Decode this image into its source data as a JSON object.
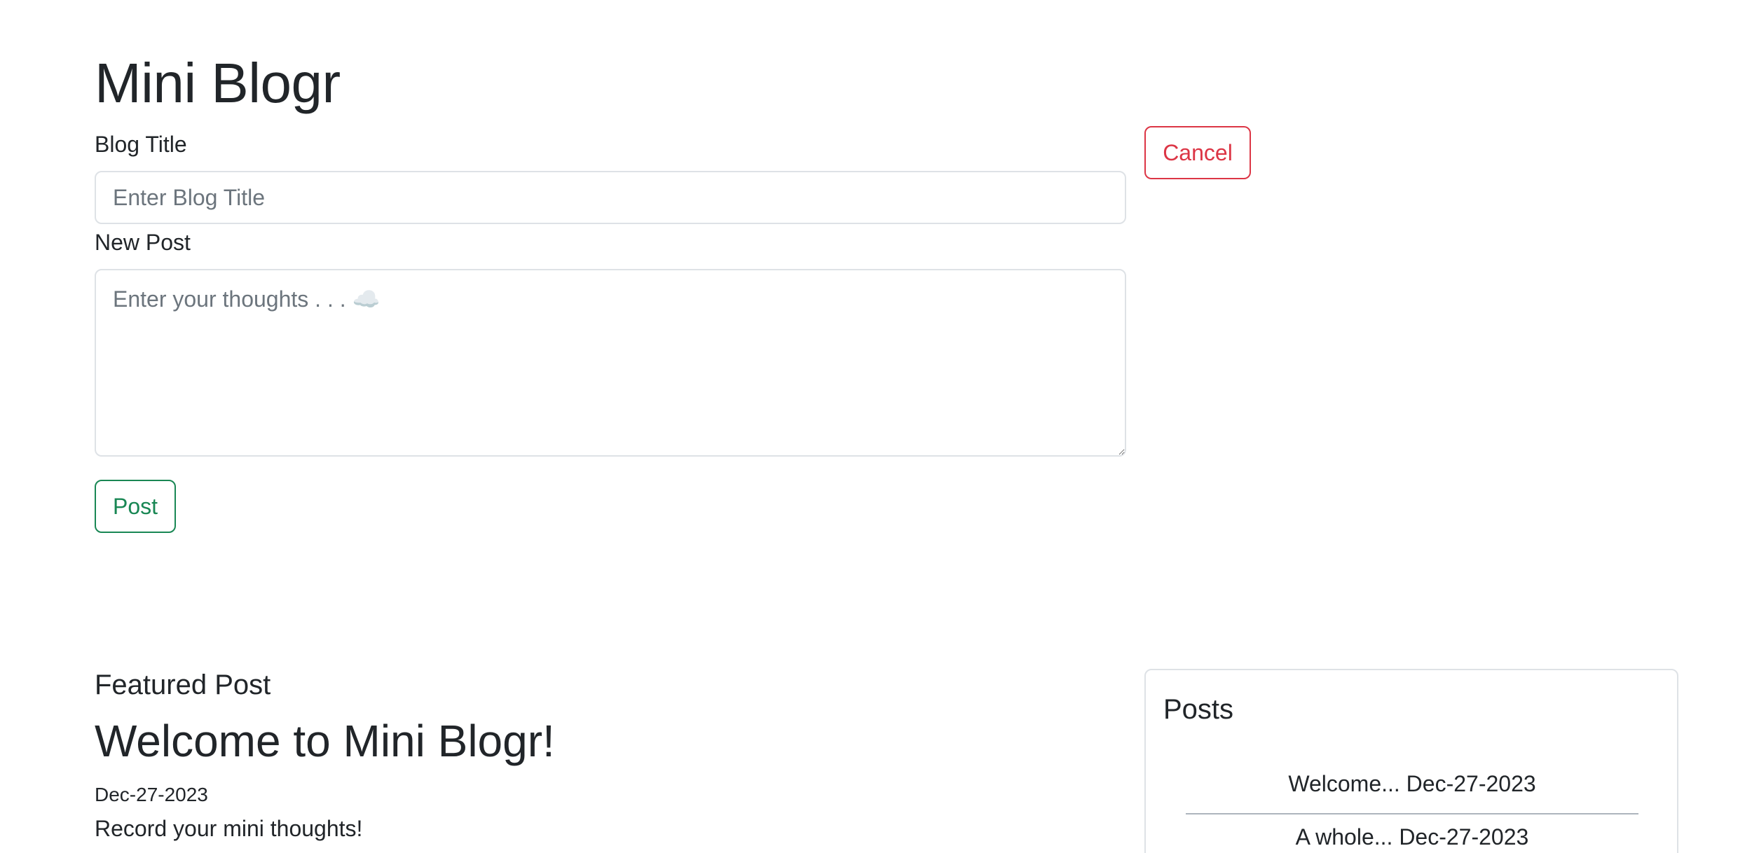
{
  "app": {
    "title": "Mini Blogr"
  },
  "form": {
    "title_label": "Blog Title",
    "title_placeholder": "Enter Blog Title",
    "post_label": "New Post",
    "post_placeholder": "Enter your thoughts . . . ☁️",
    "post_button": "Post",
    "cancel_button": "Cancel"
  },
  "featured": {
    "heading": "Featured Post",
    "title": "Welcome to Mini Blogr!",
    "date": "Dec-27-2023",
    "body": "Record your mini thoughts!"
  },
  "posts_panel": {
    "heading": "Posts",
    "items": [
      {
        "label": "Welcome... Dec-27-2023"
      },
      {
        "label": "A whole... Dec-27-2023"
      }
    ]
  },
  "colors": {
    "danger": "#dc3545",
    "success": "#198754",
    "border": "#dee2e6",
    "text": "#212529"
  }
}
